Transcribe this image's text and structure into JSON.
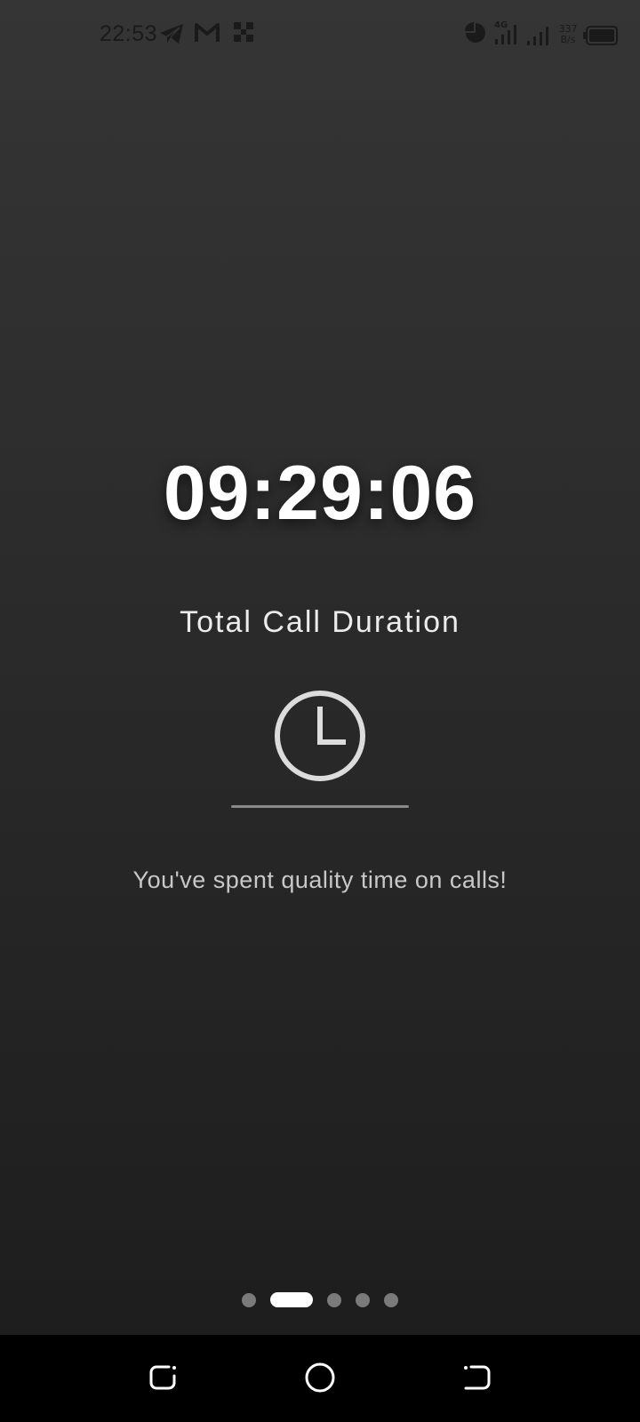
{
  "status_bar": {
    "time": "22:53",
    "notification_icons": [
      "telegram-icon",
      "gmail-icon",
      "qr-scan-icon"
    ],
    "system_icons": [
      "data-usage-icon",
      "signal-4g-icon",
      "signal-icon",
      "battery-icon"
    ],
    "network_4g_label": "4G",
    "net_speed_value": "337",
    "net_speed_unit": "B/s"
  },
  "main": {
    "timer": "09:29:06",
    "label": "Total Call Duration",
    "icon": "clock-icon",
    "message": "You've spent quality time on calls!"
  },
  "pager": {
    "count": 5,
    "active_index": 1
  },
  "nav_bar": {
    "buttons": [
      "recents-button",
      "home-button",
      "back-button"
    ]
  },
  "colors": {
    "background_top": "#353535",
    "background_bottom": "#1c1c1c",
    "text_primary": "#ffffff",
    "text_secondary": "#c8c8c8",
    "dot_inactive": "#7a7a7a",
    "dot_active": "#ffffff",
    "nav_bar": "#000000"
  }
}
